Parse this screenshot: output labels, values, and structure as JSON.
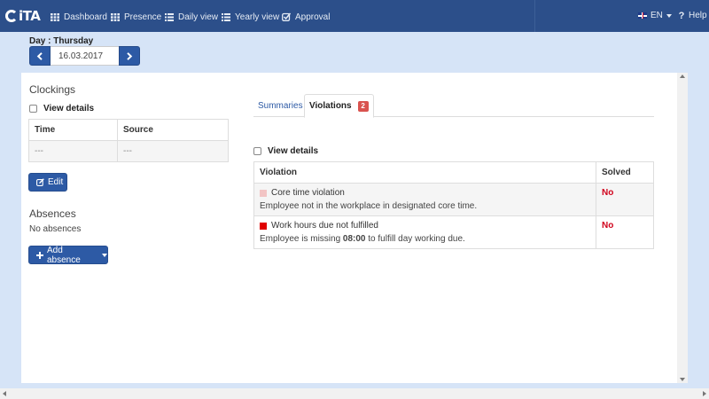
{
  "nav": {
    "brand": "iTA",
    "items": [
      {
        "label": "Dashboard",
        "icon": "grid-icon"
      },
      {
        "label": "Presence",
        "icon": "grid-icon"
      },
      {
        "label": "Daily view",
        "icon": "list-icon"
      },
      {
        "label": "Yearly view",
        "icon": "list-icon"
      },
      {
        "label": "Approval",
        "icon": "check-square-icon"
      }
    ],
    "language": "EN",
    "help": "Help"
  },
  "day": {
    "label": "Day : Thursday",
    "date": "16.03.2017"
  },
  "clockings": {
    "title": "Clockings",
    "view_details": "View details",
    "columns": [
      "Time",
      "Source"
    ],
    "rows": [
      [
        "---",
        "---"
      ]
    ],
    "edit_button": "Edit"
  },
  "absences": {
    "title": "Absences",
    "empty_text": "No absences",
    "add_button": "Add absence"
  },
  "tabs": {
    "summaries": "Summaries",
    "violations": "Violations",
    "violations_count": "2"
  },
  "violations": {
    "view_details": "View details",
    "columns": [
      "Violation",
      "Solved"
    ],
    "rows": [
      {
        "name": "Core time violation",
        "desc": "Employee not in the workplace in designated core time.",
        "color": "#f2c4c4",
        "solved": "No"
      },
      {
        "name": "Work hours due not fulfilled",
        "desc_prefix": "Employee is missing ",
        "desc_bold": "08:00",
        "desc_suffix": " to fulfill day working due.",
        "color": "#e00000",
        "solved": "No"
      }
    ]
  }
}
